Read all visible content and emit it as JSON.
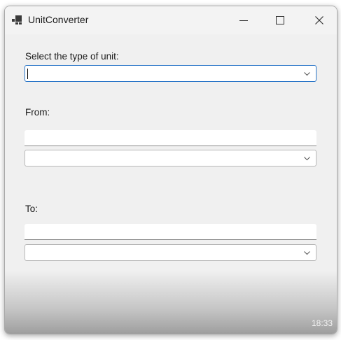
{
  "window": {
    "title": "UnitConverter",
    "controls": {
      "minimize_icon": "minimize-icon",
      "maximize_icon": "maximize-icon",
      "close_icon": "close-icon"
    }
  },
  "form": {
    "unit_type_label": "Select the type of unit:",
    "unit_type_value": "",
    "from_label": "From:",
    "from_value": "",
    "from_unit": "",
    "to_label": "To:",
    "to_value": "",
    "to_unit": ""
  },
  "taskbar": {
    "clock": "18:33"
  },
  "colors": {
    "window_bg": "#f0f0f0",
    "focus_accent": "#2a76c8"
  }
}
